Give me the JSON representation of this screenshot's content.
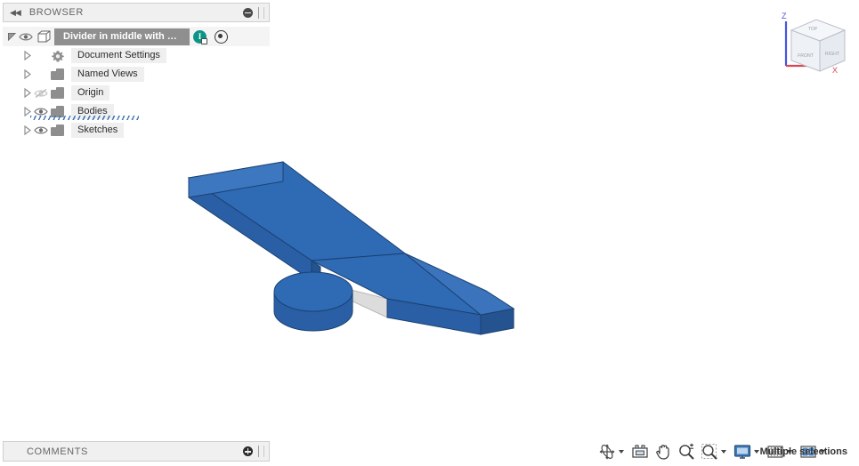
{
  "browser": {
    "header": {
      "title": "BROWSER",
      "collapse_icon": "double-left-arrow-icon",
      "minimize_icon": "circle-minus-icon",
      "grip_icon": "panel-grip-icon"
    },
    "root": {
      "label": "Divider in middle with pu...",
      "document_icon": "document-cube-icon",
      "visibility_icon": "eye-icon",
      "badge_label": "I",
      "badge_name": "unsaved-indicator-badge",
      "target_icon": "target-icon"
    },
    "items": [
      {
        "label": "Document Settings",
        "icon": "gear-icon",
        "visibility": "none",
        "expandable": true,
        "indent": 1,
        "highlighted": false
      },
      {
        "label": "Named Views",
        "icon": "folder-icon",
        "visibility": "none",
        "expandable": true,
        "indent": 1,
        "highlighted": false
      },
      {
        "label": "Origin",
        "icon": "folder-icon",
        "visibility": "hidden",
        "expandable": true,
        "indent": 1,
        "highlighted": false
      },
      {
        "label": "Bodies",
        "icon": "folder-icon",
        "visibility": "visible",
        "expandable": true,
        "indent": 1,
        "highlighted": true
      },
      {
        "label": "Sketches",
        "icon": "folder-icon",
        "visibility": "visible",
        "expandable": true,
        "indent": 1,
        "highlighted": false
      }
    ],
    "comments": {
      "title": "COMMENTS",
      "add_icon": "circle-plus-icon",
      "grip_icon": "panel-grip-icon"
    }
  },
  "viewcube": {
    "faces": {
      "top": "TOP",
      "front": "FRONT",
      "right": "RIGHT"
    },
    "axes": [
      {
        "label": "Z",
        "color": "#4455dd"
      },
      {
        "label": "X",
        "color": "#dd4455"
      }
    ]
  },
  "navbar": {
    "buttons": [
      {
        "name": "orbit-icon",
        "label": "Orbit",
        "has_caret": true
      },
      {
        "name": "look-at-icon",
        "label": "Look At",
        "has_caret": false
      },
      {
        "name": "pan-hand-icon",
        "label": "Pan",
        "has_caret": false
      },
      {
        "name": "zoom-magnifier-icon",
        "label": "Zoom",
        "has_caret": false
      },
      {
        "name": "fit-magnifier-icon",
        "label": "Fit",
        "has_caret": true
      },
      {
        "name": "display-settings-icon",
        "label": "Display Settings",
        "has_caret": true
      },
      {
        "name": "grid-snaps-icon",
        "label": "Grid and Snaps",
        "has_caret": true
      },
      {
        "name": "viewports-icon",
        "label": "Multiple Views",
        "has_caret": true
      }
    ]
  },
  "status": {
    "message": "Multiple selections"
  },
  "model": {
    "description": "Isometric blue extruded bar with a rectangular notch cut in the middle and a separate blue cylindrical puck",
    "colors": {
      "face_top": "#2f6ab4",
      "face_side": "#2a5fa5",
      "face_end": "#24538f",
      "cut_face": "#dcdcdc",
      "edge": "#1b4272"
    },
    "bodies": [
      {
        "name": "bar",
        "type": "extrusion"
      },
      {
        "name": "puck",
        "type": "cylinder"
      }
    ]
  }
}
